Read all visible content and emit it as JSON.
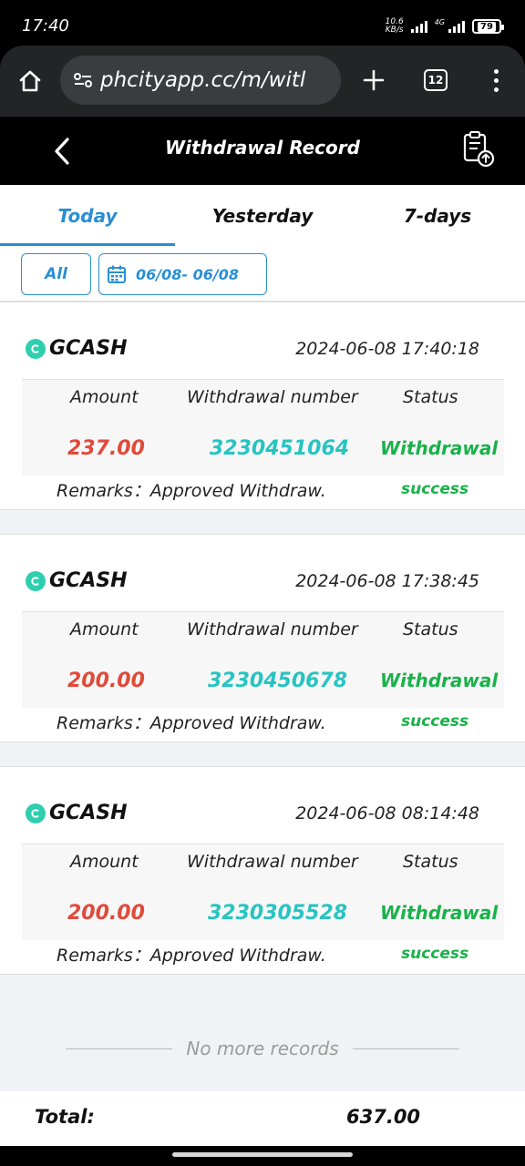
{
  "status_bar": {
    "time": "17:40",
    "net_speed_top": "10.6",
    "net_speed_bottom": "KB/s",
    "network": "4G",
    "battery": "79"
  },
  "browser": {
    "url": "phcityapp.cc/m/witl",
    "tab_count": "12"
  },
  "header": {
    "title": "Withdrawal Record"
  },
  "tabs": [
    {
      "label": "Today",
      "active": true
    },
    {
      "label": "Yesterday",
      "active": false
    },
    {
      "label": "7-days",
      "active": false
    }
  ],
  "filters": {
    "all_label": "All",
    "date_range": "06/08- 06/08"
  },
  "columns": {
    "amount": "Amount",
    "number": "Withdrawal number",
    "status": "Status"
  },
  "remarks_label": "Remarks：",
  "records": [
    {
      "method": "GCASH",
      "datetime": "2024-06-08 17:40:18",
      "amount": "237.00",
      "number": "3230451064",
      "status_line1": "Withdrawal",
      "status_line2": "success",
      "remarks": "Approved Withdraw."
    },
    {
      "method": "GCASH",
      "datetime": "2024-06-08 17:38:45",
      "amount": "200.00",
      "number": "3230450678",
      "status_line1": "Withdrawal",
      "status_line2": "success",
      "remarks": "Approved Withdraw."
    },
    {
      "method": "GCASH",
      "datetime": "2024-06-08 08:14:48",
      "amount": "200.00",
      "number": "3230305528",
      "status_line1": "Withdrawal",
      "status_line2": "success",
      "remarks": "Approved Withdraw."
    }
  ],
  "no_more_text": "No more records",
  "total": {
    "label": "Total:",
    "value": "637.00"
  },
  "colors": {
    "accent": "#2a8fd3",
    "amount": "#e04a3a",
    "number": "#27c4c2",
    "success": "#19b24a",
    "gcash": "#2ecfae"
  }
}
